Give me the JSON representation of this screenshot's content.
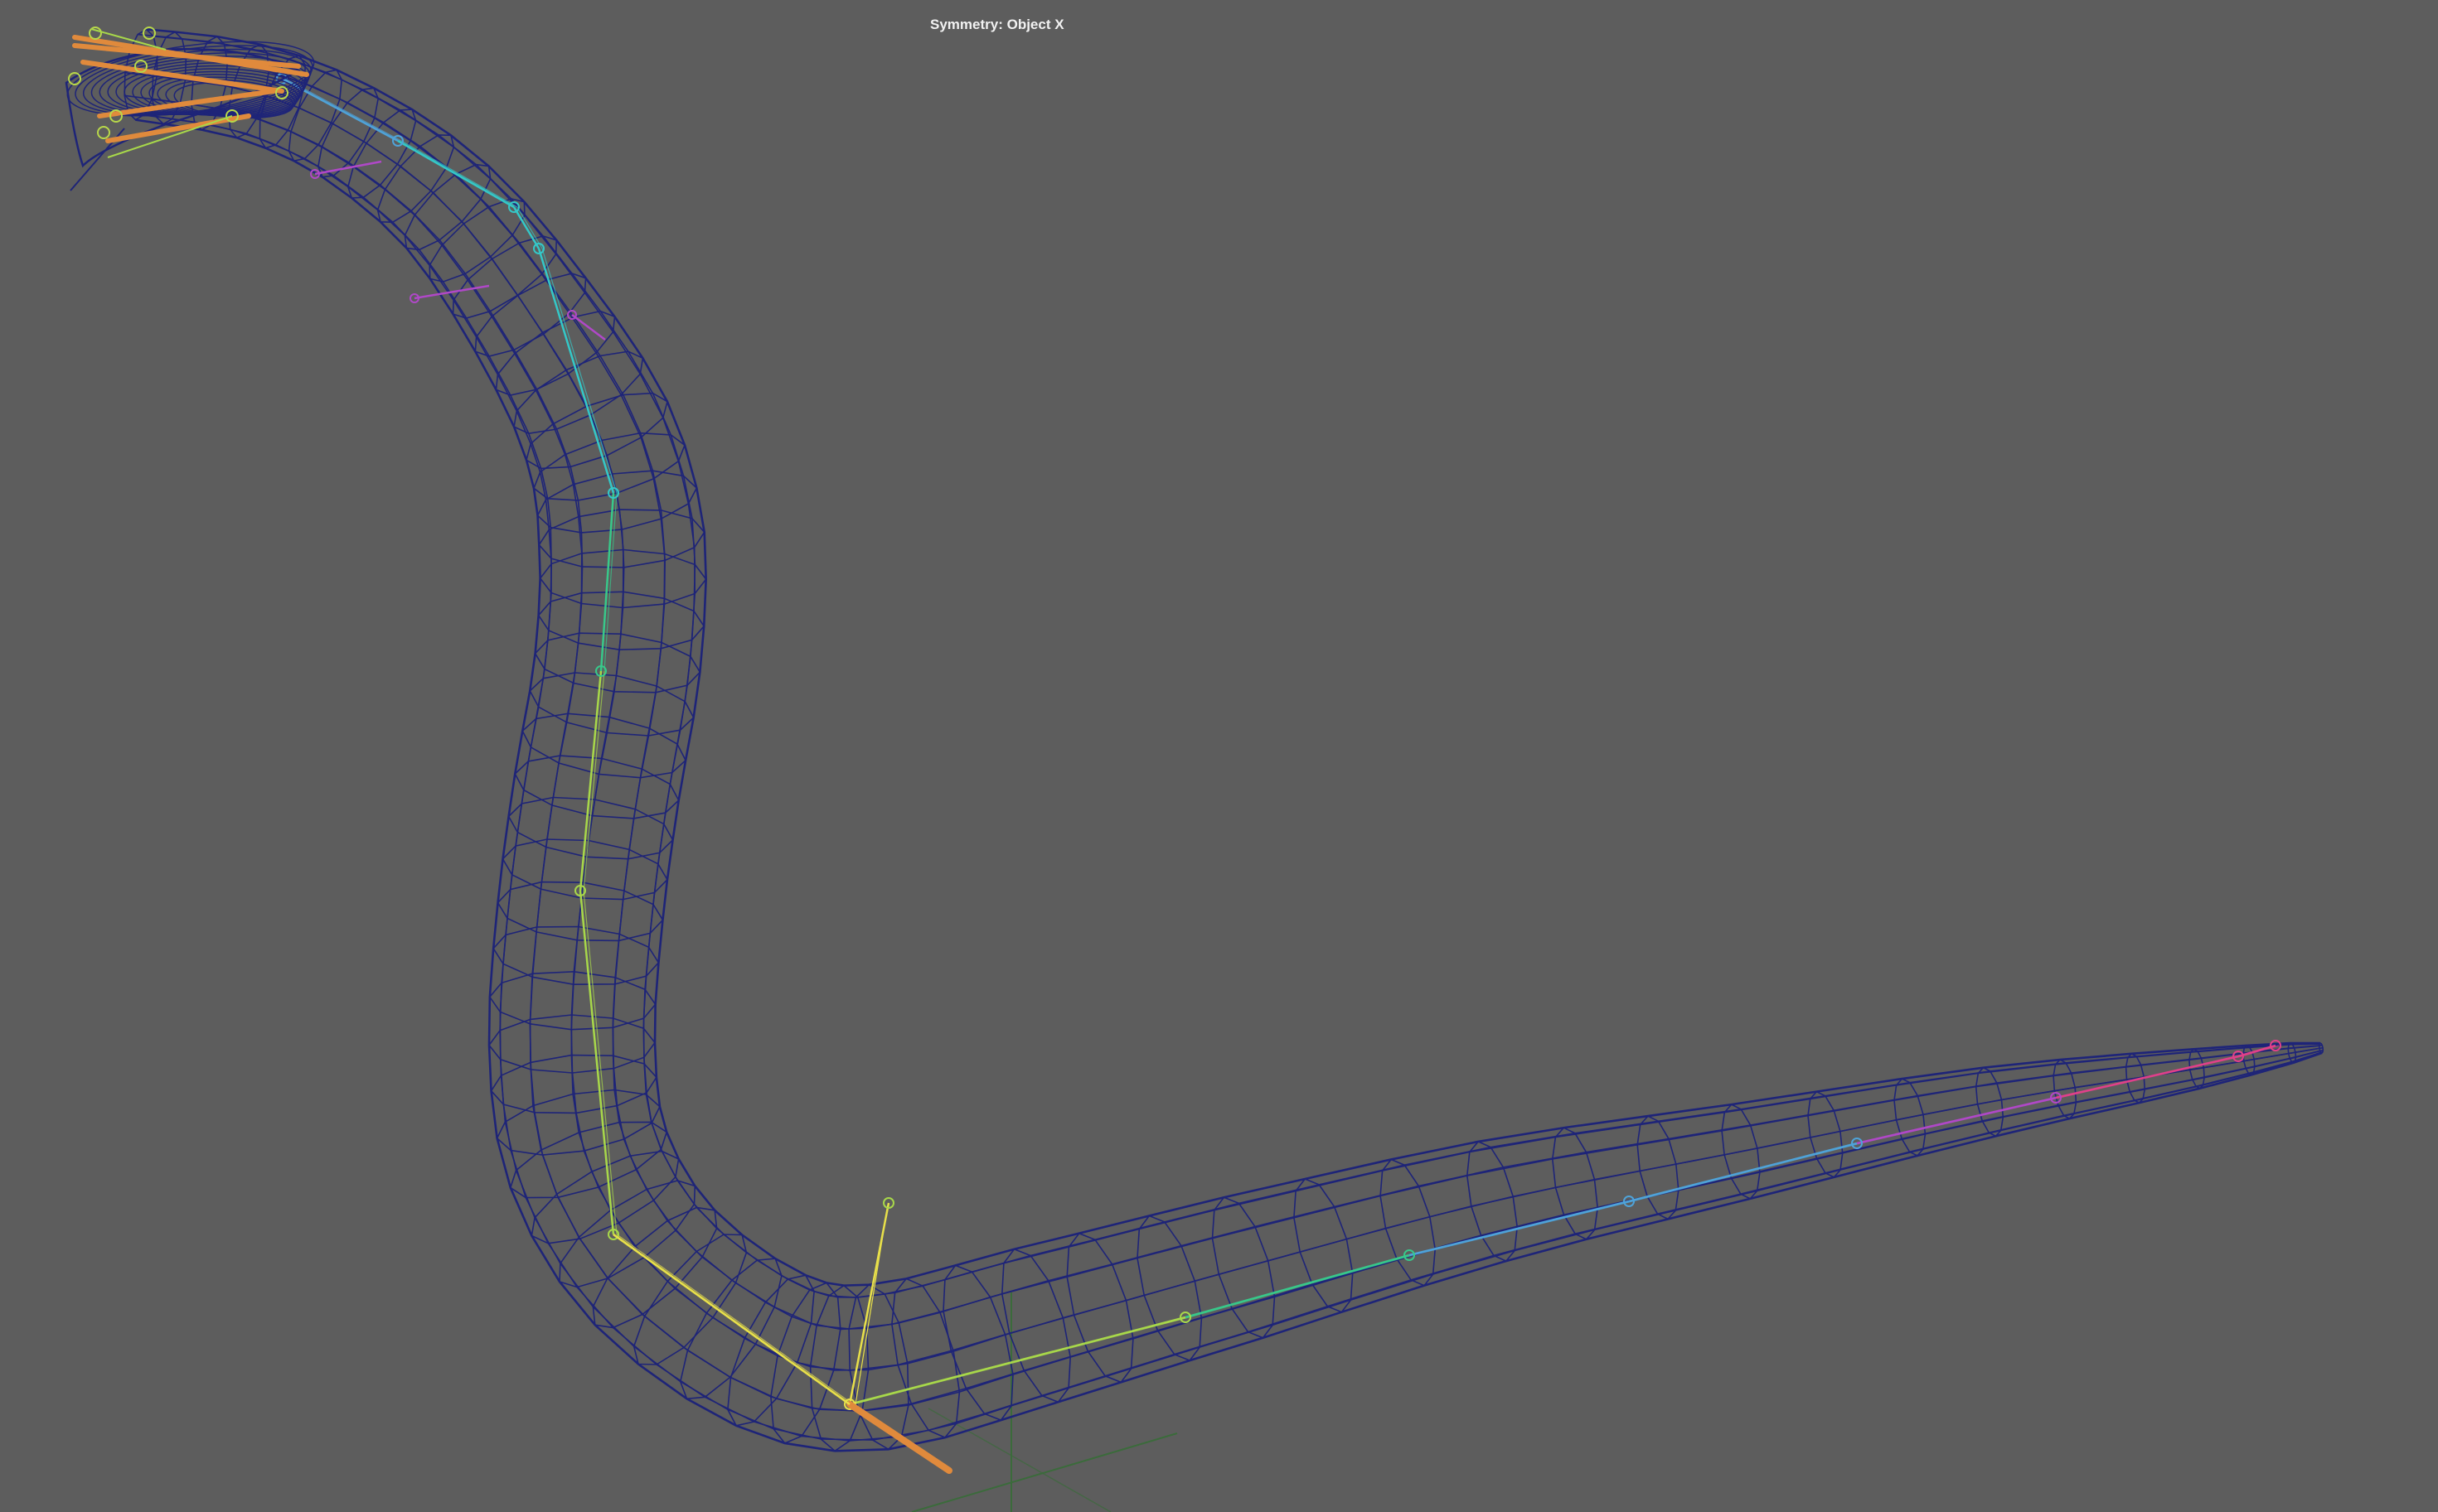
{
  "viewport": {
    "symmetry_label": "Symmetry: Object X",
    "background_color": "#5d5d5d",
    "mesh_color": "#1e2478",
    "grid_axis_color": "#3b6b3b"
  },
  "scene": {
    "objects": [
      {
        "name": "snake-body-mesh",
        "display": "wireframe",
        "color": "#1e2478"
      },
      {
        "name": "spine-joint-chain",
        "display": "joints",
        "colors": [
          "#f0a050",
          "#4fa3d9",
          "#34c8c8",
          "#38c88a",
          "#a8d84a",
          "#e8e04a",
          "#e6a040",
          "#b048c8"
        ]
      },
      {
        "name": "head-joint-cluster",
        "display": "joints",
        "color": "#e08a3c"
      }
    ]
  }
}
